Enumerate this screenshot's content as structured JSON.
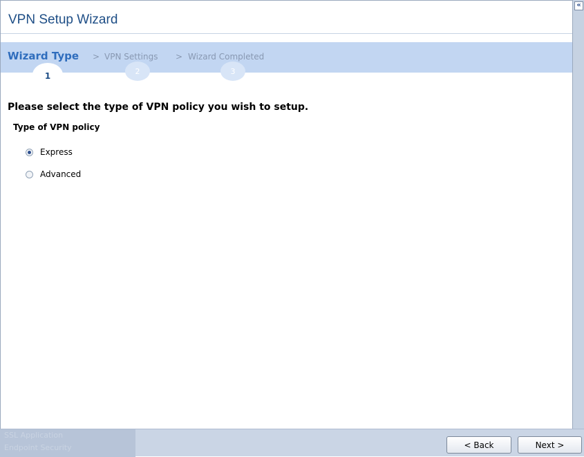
{
  "window": {
    "title": "VPN Setup Wizard"
  },
  "steps": [
    {
      "label": "Wizard Type",
      "number": "1",
      "active": true
    },
    {
      "label": "VPN Settings",
      "number": "2",
      "active": false
    },
    {
      "label": "Wizard Completed",
      "number": "3",
      "active": false
    }
  ],
  "separator": ">",
  "main": {
    "heading": "Please select the type of VPN policy you wish to setup.",
    "group_label": "Type of VPN policy",
    "options": [
      {
        "label": "Express",
        "selected": true
      },
      {
        "label": "Advanced",
        "selected": false
      }
    ]
  },
  "side_panel": {
    "collapse_glyph": "«"
  },
  "footer": {
    "left_items": [
      "SSL Application",
      "Endpoint Security"
    ],
    "back_label": "< Back",
    "next_label": "Next >"
  },
  "colors": {
    "accent": "#2f6dbd",
    "title": "#1e4e86",
    "steps_bar": "#c2d6f2"
  }
}
